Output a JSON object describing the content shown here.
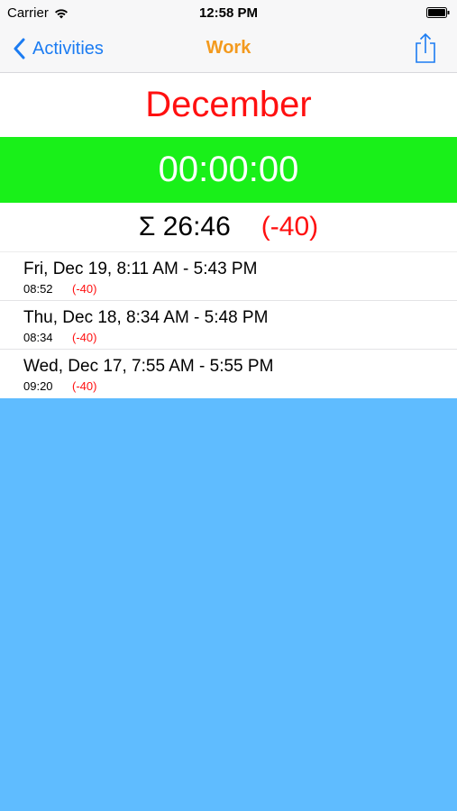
{
  "status_bar": {
    "carrier": "Carrier",
    "time": "12:58 PM"
  },
  "nav": {
    "back_label": "Activities",
    "title": "Work"
  },
  "month": "December",
  "timer": "00:00:00",
  "summary": {
    "total": "Σ 26:46",
    "diff": "(-40)"
  },
  "entries": [
    {
      "range": "Fri, Dec 19, 8:11 AM - 5:43 PM",
      "duration": "08:52",
      "delta": "(-40)"
    },
    {
      "range": "Thu, Dec 18, 8:34 AM - 5:48 PM",
      "duration": "08:34",
      "delta": "(-40)"
    },
    {
      "range": "Wed, Dec 17, 7:55 AM - 5:55 PM",
      "duration": "09:20",
      "delta": "(-40)"
    }
  ],
  "colors": {
    "accent_blue": "#1c7cf2",
    "title_orange": "#f39a1e",
    "month_red": "#ff1010",
    "timer_green": "#19f019",
    "background_blue": "#5fbcff"
  }
}
